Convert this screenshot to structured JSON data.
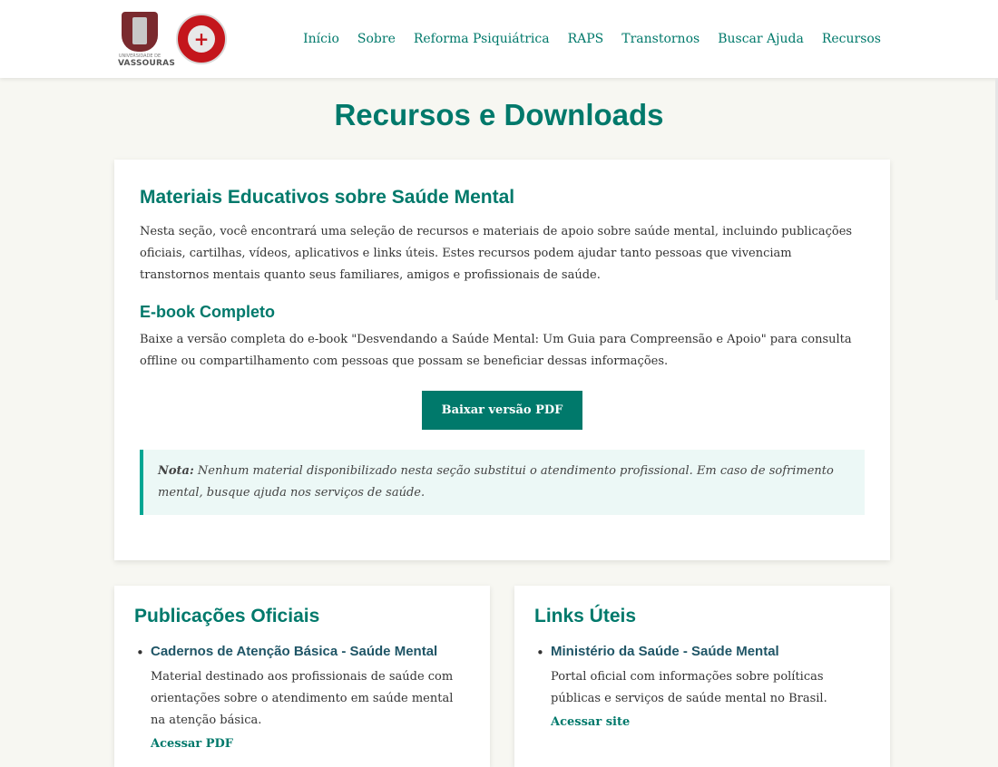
{
  "nav": {
    "logo1_small": "UNIVERSIDADE DE",
    "logo1_big": "VASSOURAS",
    "items": [
      "Início",
      "Sobre",
      "Reforma Psiquiátrica",
      "RAPS",
      "Transtornos",
      "Buscar Ajuda",
      "Recursos"
    ]
  },
  "page": {
    "title": "Recursos e Downloads"
  },
  "main": {
    "heading": "Materiais Educativos sobre Saúde Mental",
    "intro": "Nesta seção, você encontrará uma seleção de recursos e materiais de apoio sobre saúde mental, incluindo publicações oficiais, cartilhas, vídeos, aplicativos e links úteis. Estes recursos podem ajudar tanto pessoas que vivenciam transtornos mentais quanto seus familiares, amigos e profissionais de saúde.",
    "ebook_heading": "E-book Completo",
    "ebook_text": "Baixe a versão completa do e-book \"Desvendando a Saúde Mental: Um Guia para Compreensão e Apoio\" para consulta offline ou compartilhamento com pessoas que possam se beneficiar dessas informações.",
    "download_button": "Baixar versão PDF",
    "note_label": "Nota:",
    "note_text": " Nenhum material disponibilizado nesta seção substitui o atendimento profissional. Em caso de sofrimento mental, busque ajuda nos serviços de saúde."
  },
  "publications": {
    "heading": "Publicações Oficiais",
    "item_title": "Cadernos de Atenção Básica - Saúde Mental",
    "item_desc": "Material destinado aos profissionais de saúde com orientações sobre o atendimento em saúde mental na atenção básica.",
    "item_link": "Acessar PDF"
  },
  "links": {
    "heading": "Links Úteis",
    "item_title": "Ministério da Saúde - Saúde Mental",
    "item_desc": "Portal oficial com informações sobre políticas públicas e serviços de saúde mental no Brasil.",
    "item_link": "Acessar site"
  },
  "colors": {
    "accent": "#00796b",
    "note_border": "#00a693",
    "note_bg": "#ecf8f6"
  }
}
